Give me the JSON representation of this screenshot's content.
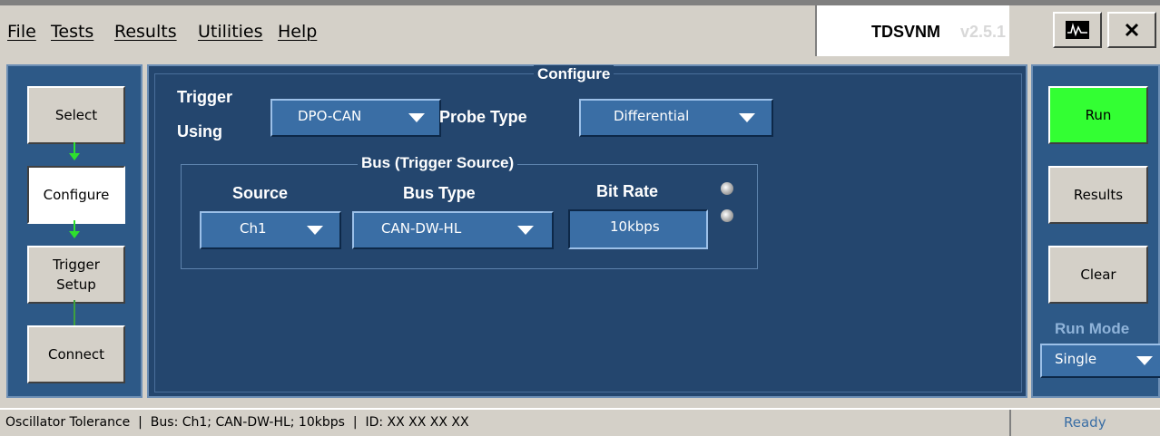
{
  "menu": [
    "File",
    "Tests",
    "Results",
    "Utilities",
    "Help"
  ],
  "app_title": "TDSVNM",
  "app_version": "v2.5.1",
  "nav": {
    "select": "Select",
    "configure": "Configure",
    "trigger_setup_line1": "Trigger",
    "trigger_setup_line2": "Setup",
    "connect": "Connect"
  },
  "configure": {
    "title": "Configure",
    "trigger_using_line1": "Trigger",
    "trigger_using_line2": "Using",
    "trigger_using_value": "DPO-CAN",
    "probe_type_label": "Probe Type",
    "probe_type_value": "Differential",
    "bus_group_title": "Bus (Trigger Source)",
    "source_label": "Source",
    "source_value": "Ch1",
    "bus_type_label": "Bus Type",
    "bus_type_value": "CAN-DW-HL",
    "bit_rate_label": "Bit Rate",
    "bit_rate_value": "10kbps"
  },
  "right": {
    "run": "Run",
    "results": "Results",
    "clear": "Clear",
    "run_mode_label": "Run Mode",
    "run_mode_value": "Single"
  },
  "status": {
    "text": "Oscillator Tolerance  |  Bus: Ch1; CAN-DW-HL; 10kbps  |  ID: XX XX XX XX",
    "ready": "Ready"
  },
  "colors": {
    "run_button": "#33ff33",
    "panel_blue": "#24466e",
    "arrow_green": "#2ee02e"
  }
}
